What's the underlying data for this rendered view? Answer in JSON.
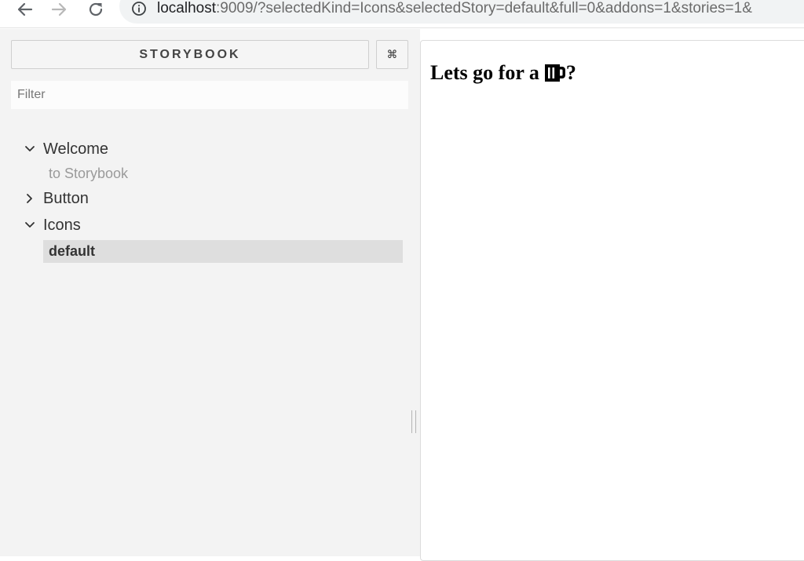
{
  "browser": {
    "url_host": "localhost",
    "url_rest": ":9009/?selectedKind=Icons&selectedStory=default&full=0&addons=1&stories=1&"
  },
  "sidebar": {
    "brand_label": "STORYBOOK",
    "shortcut_label": "⌘",
    "filter_placeholder": "Filter",
    "tree": [
      {
        "label": "Welcome",
        "expanded": true,
        "stories": [
          {
            "label": "to Storybook",
            "selected": false
          }
        ]
      },
      {
        "label": "Button",
        "expanded": false,
        "stories": []
      },
      {
        "label": "Icons",
        "expanded": true,
        "stories": [
          {
            "label": "default",
            "selected": true
          }
        ]
      }
    ]
  },
  "preview": {
    "heading_prefix": "Lets go for a",
    "icon": "beer-mug-icon",
    "heading_suffix": "?"
  },
  "colors": {
    "sidebar_bg": "#f3f3f3",
    "selected_bg": "#dedede",
    "text": "#333333",
    "muted_text": "#9a9a9a"
  }
}
